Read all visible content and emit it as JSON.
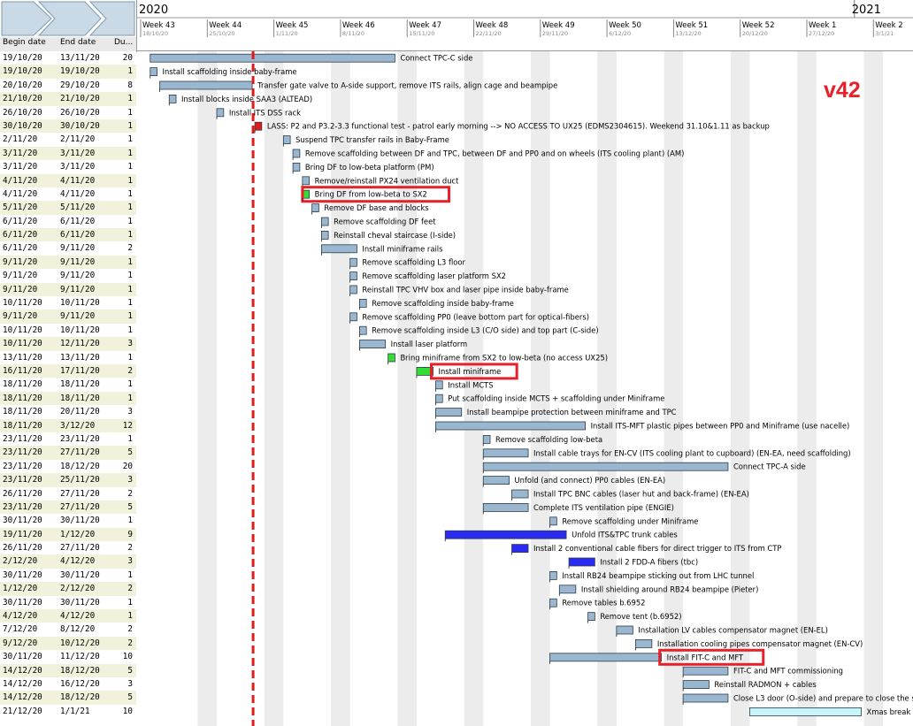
{
  "version_label": "v42",
  "columns": {
    "begin": "Begin date",
    "end": "End date",
    "duration": "Du..."
  },
  "years": [
    "2020",
    "2021"
  ],
  "weeks": [
    {
      "label": "Week 43",
      "date": "18/10/20"
    },
    {
      "label": "Week 44",
      "date": "25/10/20"
    },
    {
      "label": "Week 45",
      "date": "1/11/20"
    },
    {
      "label": "Week 46",
      "date": "8/11/20"
    },
    {
      "label": "Week 47",
      "date": "15/11/20"
    },
    {
      "label": "Week 48",
      "date": "22/11/20"
    },
    {
      "label": "Week 49",
      "date": "29/11/20"
    },
    {
      "label": "Week 50",
      "date": "6/12/20"
    },
    {
      "label": "Week 51",
      "date": "13/12/20"
    },
    {
      "label": "Week 52",
      "date": "20/12/20"
    },
    {
      "label": "Week 1",
      "date": "27/12/20"
    },
    {
      "label": "Week 2",
      "date": "3/1/21"
    }
  ],
  "today_marker_date": "30/10/20",
  "colors": {
    "bar": "#9bb7cf",
    "bar_border": "#2a3c4c",
    "milestone_red": "#e01b1b",
    "green": "#33dd33",
    "blue": "#2a2af0",
    "cyan": "#c8f6f8",
    "highlight": "#e8202a",
    "weekend": "#ececec",
    "row_alt": "#f1f1dc"
  },
  "tasks": [
    {
      "begin": "19/10/20",
      "end": "13/11/20",
      "dur": "20",
      "start": "2020-10-19",
      "finish": "2020-11-13",
      "label": "Connect TPC-C side",
      "label_pos": "right"
    },
    {
      "begin": "19/10/20",
      "end": "19/10/20",
      "dur": "1",
      "start": "2020-10-19",
      "finish": "2020-10-19",
      "label": "Install scaffolding inside baby-frame"
    },
    {
      "begin": "20/10/20",
      "end": "29/10/20",
      "dur": "8",
      "start": "2020-10-20",
      "finish": "2020-10-29",
      "label": "Transfer gate valve to A-side support, remove ITS rails, align cage and beampipe"
    },
    {
      "begin": "21/10/20",
      "end": "21/10/20",
      "dur": "1",
      "start": "2020-10-21",
      "finish": "2020-10-21",
      "label": "Install blocks inside SAA3 (ALTEAD)"
    },
    {
      "begin": "26/10/20",
      "end": "26/10/20",
      "dur": "1",
      "start": "2020-10-26",
      "finish": "2020-10-26",
      "label": "Install ITS DSS rack"
    },
    {
      "begin": "30/10/20",
      "end": "30/10/20",
      "dur": "1",
      "start": "2020-10-30",
      "finish": "2020-10-30",
      "label": "LASS: P2 and P3.2-3.3 functional test - patrol early morning --> NO ACCESS TO UX25 (EDMS2304615). Weekend 31.10&1.11 as backup",
      "color": "red"
    },
    {
      "begin": "2/11/20",
      "end": "2/11/20",
      "dur": "1",
      "start": "2020-11-02",
      "finish": "2020-11-02",
      "label": "Suspend TPC transfer rails in Baby-Frame"
    },
    {
      "begin": "3/11/20",
      "end": "3/11/20",
      "dur": "1",
      "start": "2020-11-03",
      "finish": "2020-11-03",
      "label": "Remove scaffolding between DF and TPC, between DF and PP0 and on wheels (ITS cooling plant) (AM)"
    },
    {
      "begin": "3/11/20",
      "end": "3/11/20",
      "dur": "1",
      "start": "2020-11-03",
      "finish": "2020-11-03",
      "label": "Bring DF to low-beta platform (PM)"
    },
    {
      "begin": "4/11/20",
      "end": "4/11/20",
      "dur": "1",
      "start": "2020-11-04",
      "finish": "2020-11-04",
      "label": "Remove/reinstall PX24 ventilation duct"
    },
    {
      "begin": "4/11/20",
      "end": "4/11/20",
      "dur": "1",
      "start": "2020-11-04",
      "finish": "2020-11-04",
      "label": "Bring DF from low-beta to SX2",
      "color": "green",
      "highlight": true
    },
    {
      "begin": "5/11/20",
      "end": "5/11/20",
      "dur": "1",
      "start": "2020-11-05",
      "finish": "2020-11-05",
      "label": "Remove DF base and blocks"
    },
    {
      "begin": "6/11/20",
      "end": "6/11/20",
      "dur": "1",
      "start": "2020-11-06",
      "finish": "2020-11-06",
      "label": "Remove scaffolding DF feet"
    },
    {
      "begin": "6/11/20",
      "end": "6/11/20",
      "dur": "1",
      "start": "2020-11-06",
      "finish": "2020-11-06",
      "label": "Reinstall cheval staircase (I-side)"
    },
    {
      "begin": "6/11/20",
      "end": "9/11/20",
      "dur": "2",
      "start": "2020-11-06",
      "finish": "2020-11-09",
      "label": "Install miniframe rails"
    },
    {
      "begin": "9/11/20",
      "end": "9/11/20",
      "dur": "1",
      "start": "2020-11-09",
      "finish": "2020-11-09",
      "label": "Remove scaffolding L3 floor"
    },
    {
      "begin": "9/11/20",
      "end": "9/11/20",
      "dur": "1",
      "start": "2020-11-09",
      "finish": "2020-11-09",
      "label": "Remove scaffolding laser platform SX2"
    },
    {
      "begin": "9/11/20",
      "end": "9/11/20",
      "dur": "1",
      "start": "2020-11-09",
      "finish": "2020-11-09",
      "label": "Reinstall TPC VHV box and laser pipe inside baby-frame"
    },
    {
      "begin": "10/11/20",
      "end": "10/11/20",
      "dur": "1",
      "start": "2020-11-10",
      "finish": "2020-11-10",
      "label": "Remove scaffolding inside baby-frame"
    },
    {
      "begin": "9/11/20",
      "end": "9/11/20",
      "dur": "1",
      "start": "2020-11-09",
      "finish": "2020-11-09",
      "label": "Remove scaffolding PP0 (leave bottom part for optical-fibers)"
    },
    {
      "begin": "10/11/20",
      "end": "10/11/20",
      "dur": "1",
      "start": "2020-11-10",
      "finish": "2020-11-10",
      "label": "Remove scaffolding inside L3 (C/O side) and top part (C-side)"
    },
    {
      "begin": "10/11/20",
      "end": "12/11/20",
      "dur": "3",
      "start": "2020-11-10",
      "finish": "2020-11-12",
      "label": "Install laser platform"
    },
    {
      "begin": "13/11/20",
      "end": "13/11/20",
      "dur": "1",
      "start": "2020-11-13",
      "finish": "2020-11-13",
      "label": "Bring miniframe from SX2 to low-beta (no access UX25)",
      "color": "green"
    },
    {
      "begin": "16/11/20",
      "end": "17/11/20",
      "dur": "2",
      "start": "2020-11-16",
      "finish": "2020-11-17",
      "label": "Install miniframe",
      "color": "green",
      "highlight": true
    },
    {
      "begin": "18/11/20",
      "end": "18/11/20",
      "dur": "1",
      "start": "2020-11-18",
      "finish": "2020-11-18",
      "label": "Install MCTS"
    },
    {
      "begin": "18/11/20",
      "end": "18/11/20",
      "dur": "1",
      "start": "2020-11-18",
      "finish": "2020-11-18",
      "label": "Put scaffolding inside MCTS + scaffolding under Miniframe"
    },
    {
      "begin": "18/11/20",
      "end": "20/11/20",
      "dur": "3",
      "start": "2020-11-18",
      "finish": "2020-11-20",
      "label": "Install beampipe protection between miniframe and TPC"
    },
    {
      "begin": "18/11/20",
      "end": "3/12/20",
      "dur": "12",
      "start": "2020-11-18",
      "finish": "2020-12-03",
      "label": "Install ITS-MFT plastic pipes between PP0 and Miniframe (use nacelle)"
    },
    {
      "begin": "23/11/20",
      "end": "23/11/20",
      "dur": "1",
      "start": "2020-11-23",
      "finish": "2020-11-23",
      "label": "Remove scaffolding low-beta"
    },
    {
      "begin": "23/11/20",
      "end": "27/11/20",
      "dur": "5",
      "start": "2020-11-23",
      "finish": "2020-11-27",
      "label": "Install cable trays for EN-CV (ITS cooling plant to cupboard) (EN-EA, need scaffolding)"
    },
    {
      "begin": "23/11/20",
      "end": "18/12/20",
      "dur": "20",
      "start": "2020-11-23",
      "finish": "2020-12-18",
      "label": "Connect TPC-A side"
    },
    {
      "begin": "23/11/20",
      "end": "25/11/20",
      "dur": "3",
      "start": "2020-11-23",
      "finish": "2020-11-25",
      "label": "Unfold (and connect) PP0 cables (EN-EA)"
    },
    {
      "begin": "26/11/20",
      "end": "27/11/20",
      "dur": "2",
      "start": "2020-11-26",
      "finish": "2020-11-27",
      "label": "Install TPC BNC cables (laser hut and back-frame) (EN-EA)"
    },
    {
      "begin": "23/11/20",
      "end": "27/11/20",
      "dur": "5",
      "start": "2020-11-23",
      "finish": "2020-11-27",
      "label": "Complete ITS ventilation pipe (ENGIE)"
    },
    {
      "begin": "30/11/20",
      "end": "30/11/20",
      "dur": "1",
      "start": "2020-11-30",
      "finish": "2020-11-30",
      "label": "Remove scaffolding under Miniframe"
    },
    {
      "begin": "19/11/20",
      "end": "1/12/20",
      "dur": "9",
      "start": "2020-11-19",
      "finish": "2020-12-01",
      "label": "Unfold ITS&TPC trunk cables",
      "color": "blue"
    },
    {
      "begin": "26/11/20",
      "end": "27/11/20",
      "dur": "2",
      "start": "2020-11-26",
      "finish": "2020-11-27",
      "label": "Install 2 conventional cable fibers for direct trigger to ITS from CTP",
      "color": "blue"
    },
    {
      "begin": "2/12/20",
      "end": "4/12/20",
      "dur": "3",
      "start": "2020-12-02",
      "finish": "2020-12-04",
      "label": "Install 2 FDD-A fibers (tbc)",
      "color": "blue"
    },
    {
      "begin": "30/11/20",
      "end": "30/11/20",
      "dur": "1",
      "start": "2020-11-30",
      "finish": "2020-11-30",
      "label": "Install RB24 beampipe sticking out from LHC tunnel"
    },
    {
      "begin": "1/12/20",
      "end": "2/12/20",
      "dur": "2",
      "start": "2020-12-01",
      "finish": "2020-12-02",
      "label": "Install shielding around RB24 beampipe (Pieter)"
    },
    {
      "begin": "30/11/20",
      "end": "30/11/20",
      "dur": "1",
      "start": "2020-11-30",
      "finish": "2020-11-30",
      "label": "Remove tables b.6952"
    },
    {
      "begin": "4/12/20",
      "end": "4/12/20",
      "dur": "1",
      "start": "2020-12-04",
      "finish": "2020-12-04",
      "label": "Remove tent (b.6952)"
    },
    {
      "begin": "7/12/20",
      "end": "8/12/20",
      "dur": "2",
      "start": "2020-12-07",
      "finish": "2020-12-08",
      "label": "Installation LV cables compensator magnet (EN-EL)"
    },
    {
      "begin": "9/12/20",
      "end": "10/12/20",
      "dur": "2",
      "start": "2020-12-09",
      "finish": "2020-12-10",
      "label": "Installation cooling pipes compensator magnet (EN-CV)"
    },
    {
      "begin": "30/11/20",
      "end": "11/12/20",
      "dur": "10",
      "start": "2020-11-30",
      "finish": "2020-12-11",
      "label": "Install FIT-C and MFT",
      "highlight": true
    },
    {
      "begin": "14/12/20",
      "end": "18/12/20",
      "dur": "5",
      "start": "2020-12-14",
      "finish": "2020-12-18",
      "label": "FIT-C and MFT commissioning"
    },
    {
      "begin": "14/12/20",
      "end": "16/12/20",
      "dur": "3",
      "start": "2020-12-14",
      "finish": "2020-12-16",
      "label": "Reinstall RADMON + cables"
    },
    {
      "begin": "14/12/20",
      "end": "18/12/20",
      "dur": "5",
      "start": "2020-12-14",
      "finish": "2020-12-18",
      "label": "Close L3 door (O-side) and prepare to close the se"
    },
    {
      "begin": "21/12/20",
      "end": "1/1/21",
      "dur": "10",
      "start": "2020-12-21",
      "finish": "2021-01-01",
      "label": "Xmas break",
      "color": "cyan"
    }
  ]
}
